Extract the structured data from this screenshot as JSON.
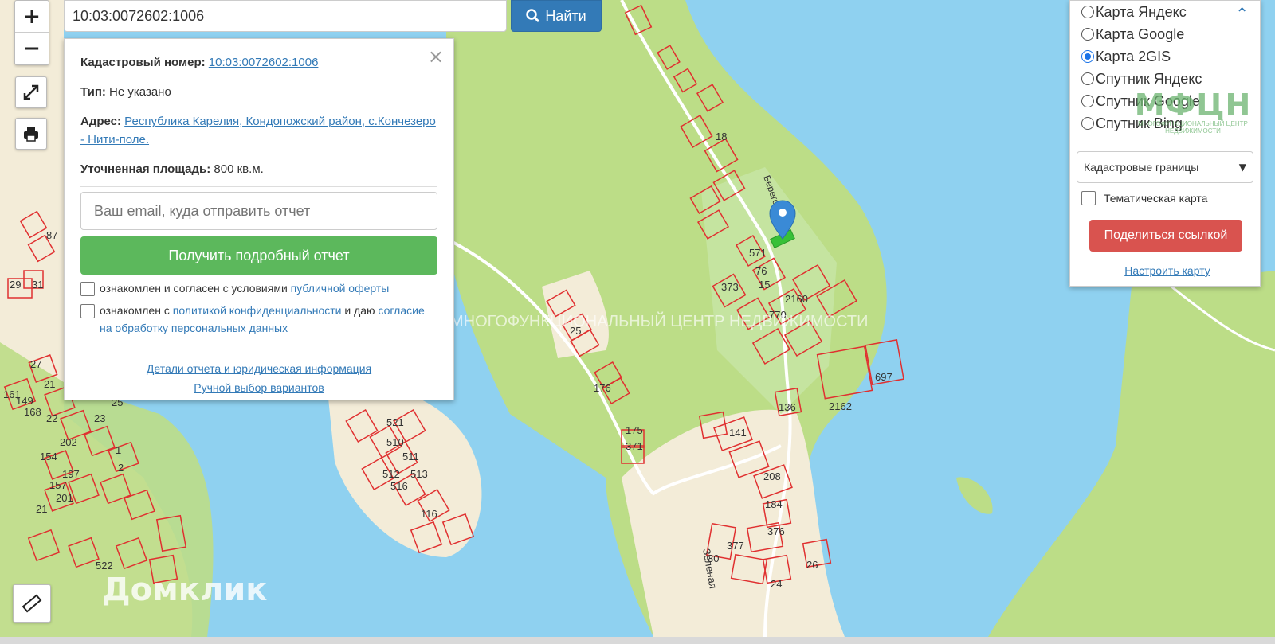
{
  "search": {
    "query": "10:03:0072602:1006",
    "button_label": "Найти"
  },
  "zoom": {
    "in_label": "+",
    "out_label": "−"
  },
  "popup": {
    "cadastral_label": "Кадастровый номер:",
    "cadastral_value": "10:03:0072602:1006",
    "type_label": "Тип:",
    "type_value": "Не указано",
    "address_label": "Адрес:",
    "address_value": "Республика Карелия, Кондопожский район, с.Кончезеро - Нити-поле.",
    "area_label": "Уточненная площадь:",
    "area_value": "800 кв.м.",
    "email_placeholder": "Ваш email, куда отправить отчет",
    "report_button": "Получить подробный отчет",
    "consent1_text": "ознакомлен и согласен с условиями",
    "consent1_link": "публичной оферты",
    "consent2_text_a": "ознакомлен с",
    "consent2_link_a": "политикой конфиденциальности",
    "consent2_text_b": "и даю",
    "consent2_link_b": "согласие на обработку персональных данных",
    "details_link": "Детали отчета и юридическая информация",
    "manual_link": "Ручной выбор вариантов"
  },
  "layers": {
    "options": [
      {
        "label": "Карта Яндекс",
        "selected": false
      },
      {
        "label": "Карта Google",
        "selected": false
      },
      {
        "label": "Карта 2GIS",
        "selected": true
      },
      {
        "label": "Спутник Яндекс",
        "selected": false
      },
      {
        "label": "Спутник Google",
        "selected": false
      },
      {
        "label": "Спутник Bing",
        "selected": false
      }
    ],
    "logo_text": "МФЦН",
    "logo_subtext": "МНОГОФУНКЦИОНАЛЬНЫЙ ЦЕНТР НЕДВИЖИМОСТИ",
    "select_value": "Кадастровые границы",
    "thematic_label": "Тематическая карта",
    "share_button": "Поделиться ссылкой",
    "configure_link": "Настроить карту"
  },
  "map": {
    "watermark": "МНОГОФУНКЦИОНАЛЬНЫЙ ЦЕНТР НЕДВИЖИМОСТИ",
    "brand": "Домклик",
    "street_label_1": "Зеленая",
    "street_label_2": "Береговая",
    "parcel_labels": [
      "87",
      "29",
      "31",
      "27",
      "21",
      "161",
      "149",
      "168",
      "22",
      "23",
      "25",
      "1",
      "2",
      "154",
      "197",
      "157",
      "201",
      "21",
      "202",
      "522",
      "521",
      "510",
      "511",
      "512",
      "513",
      "516",
      "116",
      "25",
      "176",
      "175",
      "371",
      "18",
      "571",
      "76",
      "15",
      "373",
      "770",
      "2160",
      "2162",
      "697",
      "136",
      "141",
      "208",
      "184",
      "376",
      "377",
      "30",
      "26",
      "24"
    ]
  },
  "colors": {
    "water": "#8fd1f0",
    "forest": "#bcdd87",
    "land": "#f3ecd8",
    "parcel": "#e03030",
    "selected_parcel": "#38c038",
    "marker": "#3a8ad6"
  }
}
